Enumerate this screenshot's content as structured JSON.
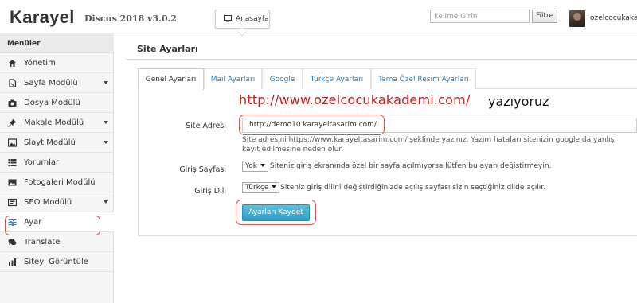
{
  "header": {
    "brand": "Karayel",
    "version": "Discus 2018 v3.0.2",
    "home_button": "Anasayfa",
    "search_placeholder": "Kelime Girin",
    "filter_button": "Filtre",
    "username": "ozelcocukaka"
  },
  "sidebar": {
    "title": "Menüler",
    "items": [
      {
        "label": "Yönetim",
        "icon": "home-icon",
        "has_submenu": false
      },
      {
        "label": "Sayfa Modülü",
        "icon": "page-icon",
        "has_submenu": true
      },
      {
        "label": "Dosya Modülü",
        "icon": "camera-icon",
        "has_submenu": false
      },
      {
        "label": "Makale Modülü",
        "icon": "pin-icon",
        "has_submenu": true
      },
      {
        "label": "Slayt Modülü",
        "icon": "image-icon",
        "has_submenu": true
      },
      {
        "label": "Yorumlar",
        "icon": "list-icon",
        "has_submenu": false
      },
      {
        "label": "Fotogaleri Modülü",
        "icon": "photo-icon",
        "has_submenu": false
      },
      {
        "label": "SEO Modülü",
        "icon": "seo-icon",
        "has_submenu": true
      },
      {
        "label": "Ayar",
        "icon": "sliders-icon",
        "has_submenu": false
      },
      {
        "label": "Translate",
        "icon": "chat-icon",
        "has_submenu": false
      },
      {
        "label": "Siteyi Görüntüle",
        "icon": "chart-icon",
        "has_submenu": false
      }
    ]
  },
  "main": {
    "title": "Site Ayarları",
    "tabs": [
      "Genel Ayarları",
      "Mail Ayarları",
      "Google",
      "Türkçe Ayarları",
      "Tema Özel Resim Ayarları"
    ],
    "active_tab": 0,
    "annotation_url": "http://www.ozelcocukakademi.com/",
    "annotation_text": "yazıyoruz",
    "site_address_label": "Site Adresi",
    "site_address_value": "http://demo10.karayeltasarim.com/",
    "site_address_help": "Site adresini https://www.karayeltasarim.com/ şeklinde yazınız. Yazım hataları sitenizin google da yanlış kayıt edilmesine neden olur.",
    "login_page_label": "Giriş Sayfası",
    "login_page_value": "Yok",
    "login_page_help": "Siteniz giriş ekranında özel bir sayfa açılmıyorsa lütfen bu ayarı değiştirmeyin.",
    "login_lang_label": "Giriş Dili",
    "login_lang_value": "Türkçe",
    "login_lang_help": "Siteniz giriş dilini değiştirdiğinizde açılış sayfası sizin seçtiğiniz dilde açılır.",
    "save_button": "Ayarları Kaydet"
  },
  "colors": {
    "accent_link": "#2a7bbf",
    "save_button": "#39a8d2",
    "annotation_red": "#c21f1f",
    "highlight_red": "#d9534f"
  }
}
